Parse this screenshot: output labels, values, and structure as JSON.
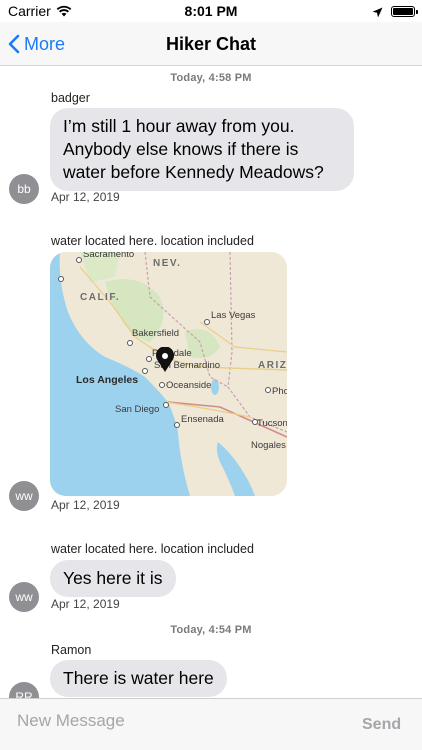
{
  "status_bar": {
    "carrier": "Carrier",
    "time": "8:01 PM",
    "wifi_icon": "wifi-icon",
    "location_icon": "location-arrow-icon",
    "battery_icon": "battery-icon",
    "battery_level": 1.0
  },
  "nav": {
    "back_label": "More",
    "title": "Hiker Chat",
    "accent_color": "#1a7cf5"
  },
  "messages": [
    {
      "timestamp": "Today, 4:58 PM",
      "sender": "badger",
      "text": "I’m still 1 hour away from you. Anybody else knows if there is water before Kennedy Meadows?",
      "date": "Apr 12, 2019",
      "avatar": "bb"
    },
    {
      "sender": "water located here. location included",
      "type": "map",
      "date": "Apr 12, 2019",
      "avatar": "ww",
      "map_labels": {
        "sacramento": "Sacramento",
        "nev": "NEV.",
        "calif": "CALIF.",
        "las_vegas": "Las Vegas",
        "bakersfield": "Bakersfield",
        "palmdale": "Palmdale",
        "san_bernardino": "San Bernardino",
        "los_angeles": "Los Angeles",
        "oceanside": "Oceanside",
        "ariz": "ARIZ",
        "phoenix": "Pho",
        "san_diego": "San Diego",
        "ensenada": "Ensenada",
        "tucson": "Tucson",
        "nogales": "Nogales"
      }
    },
    {
      "sender": "water located here. location included",
      "text": "Yes here it is",
      "date": "Apr 12, 2019",
      "avatar": "ww"
    },
    {
      "timestamp": "Today, 4:54 PM",
      "sender": "Ramon",
      "text": "There is water here",
      "avatar": "RR"
    }
  ],
  "input": {
    "placeholder": "New Message",
    "value": "",
    "send_label": "Send",
    "send_color": "#a5a5aa"
  },
  "colors": {
    "bubble": "#e6e6ea",
    "avatar": "#8f8f94",
    "water": "#9dd2ee",
    "land": "#efe8d7"
  }
}
